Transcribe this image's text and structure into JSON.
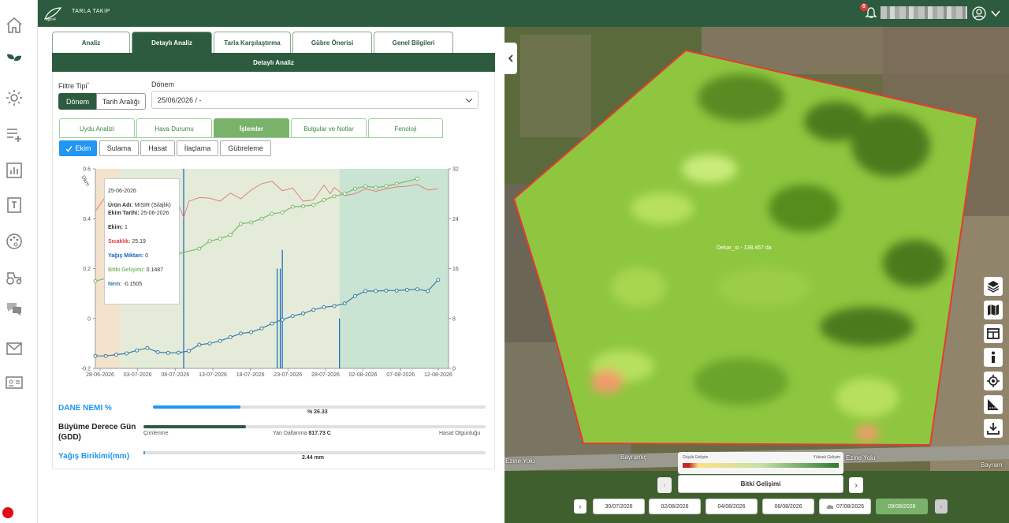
{
  "header": {
    "app_title": "TARLA TAKIP",
    "notification_count": "0",
    "brand_color": "#2c5b3f"
  },
  "sidebar": {
    "items": [
      {
        "icon": "home-icon"
      },
      {
        "icon": "sprout-icon"
      },
      {
        "icon": "sun-icon"
      },
      {
        "icon": "list-add-icon"
      },
      {
        "icon": "bar-chart-icon"
      },
      {
        "icon": "document-t-icon"
      },
      {
        "icon": "palette-icon"
      },
      {
        "icon": "tractor-icon"
      },
      {
        "icon": "chat-icon"
      },
      {
        "icon": "mail-icon"
      },
      {
        "icon": "id-card-icon"
      }
    ]
  },
  "main_tabs": [
    "Analiz",
    "Detaylı Analiz",
    "Tarla Karşılaştırma",
    "Gübre Önerisi",
    "Genel Bilgileri"
  ],
  "active_main_tab": "Detaylı Analiz",
  "section_title": "Detaylı Analiz",
  "filter": {
    "label": "Filtre Tipi",
    "required_mark": "*",
    "options": [
      "Dönem",
      "Tarih Aralığı"
    ],
    "selected": "Dönem"
  },
  "period": {
    "label": "Dönem",
    "value": "25/06/2026 / -"
  },
  "sub_tabs": [
    "Uydu Analizi",
    "Hava Durumu",
    "İşlemler",
    "Bulgular ve Notlar",
    "Fenoloji"
  ],
  "active_sub_tab": "İşlemler",
  "operations": [
    "Ekim",
    "Sulama",
    "Hasat",
    "İlaçlama",
    "Gübreleme"
  ],
  "active_operation": "Ekim",
  "chart_data": {
    "type": "line",
    "x_tick_labels": [
      "28-06-2026",
      "03-07-2026",
      "08-07-2026",
      "13-07-2026",
      "18-07-2026",
      "23-07-2026",
      "28-07-2026",
      "02-08-2026",
      "07-08-2026",
      "12-08-2026"
    ],
    "y_left_ticks": [
      "0.6",
      "0.4",
      "0.2",
      "0",
      "-0.2"
    ],
    "y_right_ticks": [
      "32",
      "24",
      "16",
      "8",
      "0"
    ],
    "y_left_label": "Dkm",
    "ylim_left": [
      -0.2,
      0.6
    ],
    "ylim_right": [
      0,
      32
    ],
    "phases": [
      {
        "start": 0,
        "end": 2.4,
        "color": "#f3e3cc"
      },
      {
        "start": 2.4,
        "end": 23.5,
        "color": "#e4ecd9"
      },
      {
        "start": 23.5,
        "end": 34,
        "color": "#c9e4d2"
      }
    ],
    "x_start_day": 0,
    "x_end_day": 34,
    "series": [
      {
        "name": "Sıcaklık",
        "axis": "right",
        "color": "#e57373",
        "points": [
          [
            0,
            25.2
          ],
          [
            1,
            27.6
          ],
          [
            2,
            28.1
          ],
          [
            3,
            27.2
          ],
          [
            4,
            25.6
          ],
          [
            5,
            26.3
          ],
          [
            6,
            24.8
          ],
          [
            7,
            24.6
          ],
          [
            8,
            26.4
          ],
          [
            8.5,
            24.2
          ],
          [
            9,
            26.8
          ],
          [
            10,
            27.4
          ],
          [
            11,
            27.3
          ],
          [
            12,
            26.8
          ],
          [
            13,
            28.1
          ],
          [
            14,
            27.2
          ],
          [
            15,
            28.6
          ],
          [
            16,
            29.6
          ],
          [
            17,
            30.0
          ],
          [
            18,
            28.5
          ],
          [
            19,
            28.9
          ],
          [
            20,
            26.8
          ],
          [
            21,
            27.0
          ],
          [
            22,
            29.4
          ],
          [
            22.6,
            28.0
          ],
          [
            23,
            29.0
          ],
          [
            24,
            27.7
          ],
          [
            25,
            28.0
          ],
          [
            26,
            28.8
          ],
          [
            27,
            28.4
          ],
          [
            28,
            28.8
          ],
          [
            29,
            29.1
          ],
          [
            30,
            29.2
          ],
          [
            31,
            29.5
          ],
          [
            32,
            28.6
          ],
          [
            33,
            28.8
          ]
        ]
      },
      {
        "name": "Bitki Gelişimi",
        "axis": "left",
        "color": "#7cb96b",
        "points": [
          [
            0,
            0.15
          ],
          [
            4.7,
            0.2
          ],
          [
            6,
            0.225
          ],
          [
            7,
            0.245
          ],
          [
            8,
            0.26
          ],
          [
            10,
            0.28
          ],
          [
            11,
            0.31
          ],
          [
            12,
            0.32
          ],
          [
            13,
            0.335
          ],
          [
            14,
            0.38
          ],
          [
            15,
            0.385
          ],
          [
            16,
            0.4
          ],
          [
            17,
            0.42
          ],
          [
            18,
            0.425
          ],
          [
            19,
            0.448
          ],
          [
            20,
            0.45
          ],
          [
            21,
            0.455
          ],
          [
            22,
            0.475
          ],
          [
            23,
            0.49
          ],
          [
            24,
            0.5
          ],
          [
            25,
            0.52
          ],
          [
            26,
            0.53
          ],
          [
            27,
            0.525
          ],
          [
            28,
            0.53
          ],
          [
            29,
            0.54
          ],
          [
            31,
            0.56
          ]
        ]
      },
      {
        "name": "Nem",
        "axis": "left",
        "color": "#3a7ca5",
        "points": [
          [
            0,
            -0.15
          ],
          [
            1,
            -0.15
          ],
          [
            2,
            -0.145
          ],
          [
            3,
            -0.14
          ],
          [
            4,
            -0.128
          ],
          [
            5,
            -0.118
          ],
          [
            6,
            -0.135
          ],
          [
            7,
            -0.138
          ],
          [
            8,
            -0.137
          ],
          [
            9,
            -0.13
          ],
          [
            10,
            -0.105
          ],
          [
            11,
            -0.1
          ],
          [
            12,
            -0.09
          ],
          [
            13,
            -0.075
          ],
          [
            14,
            -0.06
          ],
          [
            15,
            -0.055
          ],
          [
            16,
            -0.04
          ],
          [
            17,
            -0.02
          ],
          [
            18,
            -0.005
          ],
          [
            19,
            0.01
          ],
          [
            20,
            0.02
          ],
          [
            21,
            0.035
          ],
          [
            22,
            0.045
          ],
          [
            23,
            0.05
          ],
          [
            24,
            0.06
          ],
          [
            25,
            0.09
          ],
          [
            26,
            0.11
          ],
          [
            27,
            0.11
          ],
          [
            28,
            0.112
          ],
          [
            29,
            0.112
          ],
          [
            30,
            0.115
          ],
          [
            31,
            0.117
          ],
          [
            32,
            0.11
          ],
          [
            33,
            0.155
          ]
        ]
      },
      {
        "name": "Yağış Miktarı",
        "axis": "right",
        "color": "#1565c0",
        "type": "bar",
        "points": [
          [
            8.5,
            32
          ],
          [
            17.5,
            16
          ],
          [
            17.8,
            16
          ],
          [
            18,
            19
          ],
          [
            23.5,
            8
          ]
        ]
      }
    ]
  },
  "tooltip": {
    "date": "25-06-2026",
    "crop_label": "Ürün Adı:",
    "crop_value": "MISIR (Silajlık)",
    "sowing_label": "Ekim Tarihi:",
    "sowing_value": "25-06-2026",
    "sowing_count_label": "Ekim:",
    "sowing_count_value": "1",
    "temp_label": "Sıcaklık:",
    "temp_value": "25.19",
    "rain_label": "Yağış Miktarı:",
    "rain_value": "0",
    "growth_label": "Bitki Gelişimi:",
    "growth_value": "0.1487",
    "moisture_label": "Nem:",
    "moisture_value": "-0.1505"
  },
  "metrics": {
    "grain_moisture": {
      "label": "DANE NEMI %",
      "value": "% 26.33",
      "percent": 26.33,
      "color": "#2196f3"
    },
    "gdd": {
      "label_line1": "Büyüme Derece Gün",
      "label_line2": "(GDD)",
      "stage_start": "Çimlenme",
      "stage_mid": "Yan Dallanma",
      "stage_mid_value": "817.73 C",
      "stage_end": "Hasat Olgunluğu",
      "progress": 0.3,
      "color": "#2c5b3f"
    },
    "rainfall": {
      "label": "Yağış Birikimi(mm)",
      "value": "2.44 mm",
      "progress": 0.003,
      "color": "#2196f3"
    }
  },
  "map": {
    "field_label": "Dekar_ıo - 138.467 da",
    "road_label_1": "Bayramiç",
    "road_label_2": "Ezine Yolu",
    "road_label_3": "Bayram",
    "road_label_4": "Ezine Yolu",
    "legend_low": "Düşük Gelişim",
    "legend_high": "Yüksek Gelişim",
    "layer": "Bitki Gelişimi",
    "dates": [
      "30/07/2026",
      "02/08/2026",
      "04/08/2026",
      "06/08/2026",
      "07/08/2026",
      "09/08/2026"
    ],
    "active_date": "09/08/2026",
    "tools": [
      "layers-icon",
      "map-icon",
      "split-view-icon",
      "info-icon",
      "locate-icon",
      "ruler-icon",
      "download-icon"
    ]
  }
}
